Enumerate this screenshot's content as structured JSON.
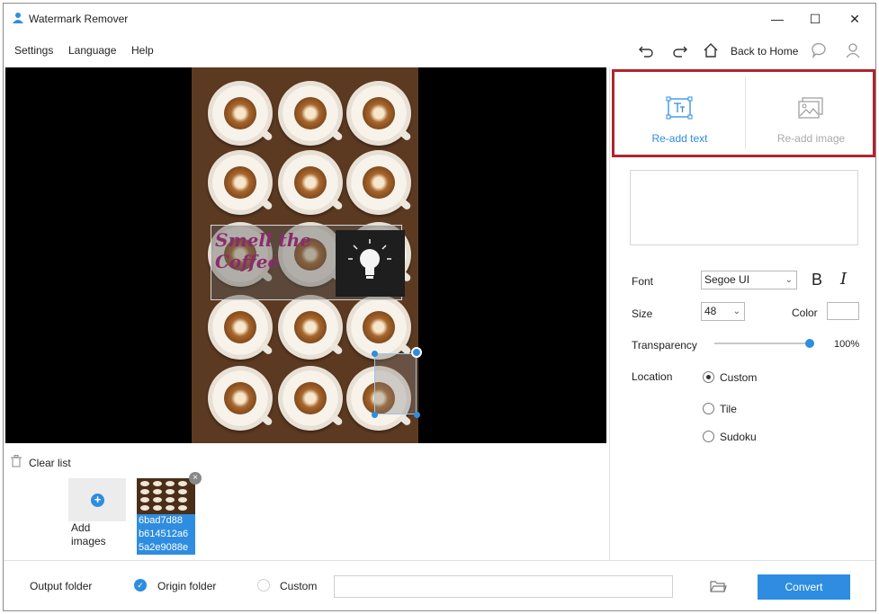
{
  "window": {
    "title": "Watermark Remover",
    "controls": {
      "minimize": "—",
      "maximize": "☐",
      "close": "✕"
    }
  },
  "menu": {
    "items": [
      "Settings",
      "Language",
      "Help"
    ]
  },
  "toolbar": {
    "back_home_label": "Back to Home",
    "icons": [
      "undo-icon",
      "redo-icon",
      "home-icon",
      "chat-icon",
      "user-icon"
    ]
  },
  "canvas": {
    "watermark_text": "Smell the Coffee",
    "colors": {
      "background": "#000000",
      "photo": "#5c3a22",
      "watermark": "#8a2c6b"
    }
  },
  "file_list": {
    "clear_label": "Clear list",
    "add_plus": "+",
    "add_label": "Add images",
    "thumb_close": "×",
    "items": [
      {
        "name_lines": [
          "6bad7d88",
          "b614512a6",
          "5a2e9088e"
        ]
      }
    ]
  },
  "panel": {
    "readd_text_label": "Re-add text",
    "readd_image_label": "Re-add image",
    "font_label": "Font",
    "font_value": "Segoe UI",
    "bold_label": "B",
    "italic_label": "I",
    "size_label": "Size",
    "size_value": "48",
    "color_label": "Color",
    "transparency_label": "Transparency",
    "transparency_value": "100%",
    "transparency_level": 1.0,
    "location_label": "Location",
    "location_options": [
      {
        "label": "Custom",
        "selected": true
      },
      {
        "label": "Tile",
        "selected": false
      },
      {
        "label": "Sudoku",
        "selected": false
      }
    ],
    "chevron": "⌄"
  },
  "footer": {
    "output_folder_label": "Output folder",
    "origin_folder_label": "Origin folder",
    "origin_checked": "✓",
    "custom_label": "Custom",
    "path_value": "",
    "convert_label": "Convert"
  },
  "accent_color": "#2e8de0",
  "highlight_color": "#b0252d"
}
